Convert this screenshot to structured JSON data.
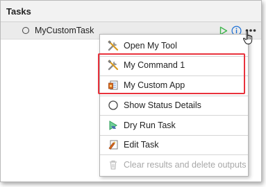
{
  "panel": {
    "title": "Tasks"
  },
  "task": {
    "name": "MyCustomTask",
    "run_icon": "run-triangle-icon",
    "info_icon": "info-icon",
    "more_icon": "more-options-icon"
  },
  "menu": {
    "items": [
      {
        "label": "Open My Tool",
        "icon": "tools-icon",
        "enabled": true
      },
      {
        "label": "My Command 1",
        "icon": "tools-icon",
        "enabled": true
      },
      {
        "label": "My Custom App",
        "icon": "app-icon",
        "enabled": true
      },
      {
        "label": "Show Status Details",
        "icon": "status-circle-icon",
        "enabled": true
      },
      {
        "label": "Dry Run Task",
        "icon": "dry-run-icon",
        "enabled": true
      },
      {
        "label": "Edit Task",
        "icon": "edit-task-icon",
        "enabled": true
      },
      {
        "label": "Clear results and delete outputs",
        "icon": "trash-icon",
        "enabled": false
      }
    ]
  },
  "colors": {
    "highlight": "#e8323c",
    "run_green": "#3cb54a",
    "info_blue": "#1a6fd6"
  }
}
